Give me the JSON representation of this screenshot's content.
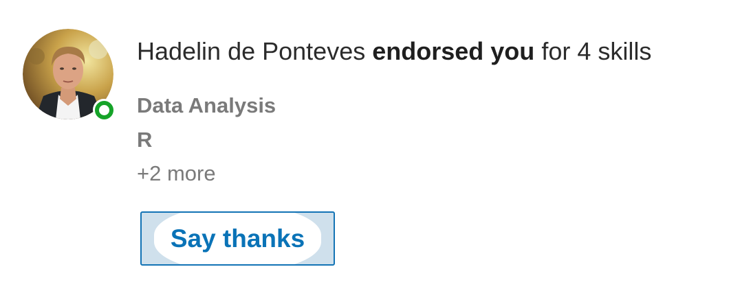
{
  "notification": {
    "actor_name": "Hadelin de Ponteves",
    "action": "endorsed you",
    "suffix": "for 4 skills"
  },
  "skills": [
    "Data Analysis",
    "R"
  ],
  "more_text": "+2 more",
  "button": {
    "label": "Say thanks"
  },
  "colors": {
    "accent": "#0a73b7",
    "online": "#16a329",
    "muted_text": "#7a7a7a"
  },
  "icons": {
    "presence": "online-status-icon",
    "avatar": "profile-photo"
  }
}
